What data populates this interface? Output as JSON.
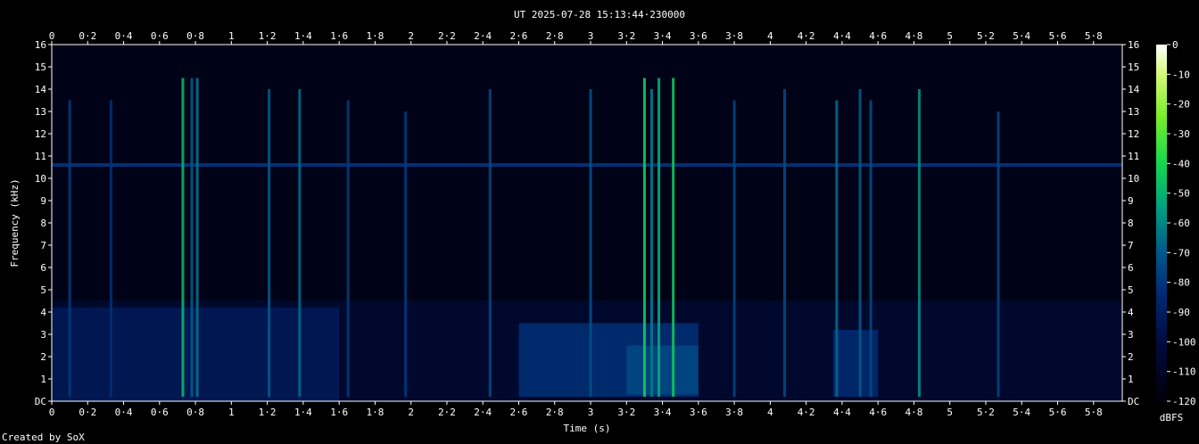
{
  "chart_data": {
    "type": "heatmap",
    "title": "UT 2025-07-28 15:13:44·230000",
    "xlabel": "Time (s)",
    "ylabel": "Frequency (kHz)",
    "xlim": [
      0,
      5.96
    ],
    "ylim": [
      0,
      16
    ],
    "x_ticks": [
      "0",
      "0·2",
      "0·4",
      "0·6",
      "0·8",
      "1",
      "1·2",
      "1·4",
      "1·6",
      "1·8",
      "2",
      "2·2",
      "2·4",
      "2·6",
      "2·8",
      "3",
      "3·2",
      "3·4",
      "3·6",
      "3·8",
      "4",
      "4·2",
      "4·4",
      "4·6",
      "4·8",
      "5",
      "5·2",
      "5·4",
      "5·6",
      "5·8"
    ],
    "y_ticks": [
      "DC",
      "1",
      "2",
      "3",
      "4",
      "5",
      "6",
      "7",
      "8",
      "9",
      "10",
      "11",
      "12",
      "13",
      "14",
      "15",
      "16"
    ],
    "colorbar": {
      "label": "dBFS",
      "ticks": [
        "0",
        "-10",
        "-20",
        "-30",
        "-40",
        "-50",
        "-60",
        "-70",
        "-80",
        "-90",
        "-100",
        "-110",
        "-120"
      ],
      "range": [
        -120,
        0
      ]
    },
    "grid": false,
    "horizontal_lines": [
      {
        "freq_khz": 10.6,
        "level_dbfs": -88
      }
    ],
    "vertical_events": [
      {
        "t": 0.1,
        "top_khz": 13.5,
        "level_dbfs": -85
      },
      {
        "t": 0.33,
        "top_khz": 13.5,
        "level_dbfs": -88
      },
      {
        "t": 0.73,
        "top_khz": 14.5,
        "level_dbfs": -55
      },
      {
        "t": 0.78,
        "top_khz": 14.5,
        "level_dbfs": -75
      },
      {
        "t": 0.81,
        "top_khz": 14.5,
        "level_dbfs": -70
      },
      {
        "t": 1.21,
        "top_khz": 14.0,
        "level_dbfs": -75
      },
      {
        "t": 1.38,
        "top_khz": 14.0,
        "level_dbfs": -72
      },
      {
        "t": 1.65,
        "top_khz": 13.5,
        "level_dbfs": -85
      },
      {
        "t": 1.97,
        "top_khz": 13.0,
        "level_dbfs": -85
      },
      {
        "t": 2.44,
        "top_khz": 14.0,
        "level_dbfs": -80
      },
      {
        "t": 3.0,
        "top_khz": 14.0,
        "level_dbfs": -78
      },
      {
        "t": 3.3,
        "top_khz": 14.5,
        "level_dbfs": -48
      },
      {
        "t": 3.34,
        "top_khz": 14.0,
        "level_dbfs": -68
      },
      {
        "t": 3.38,
        "top_khz": 14.5,
        "level_dbfs": -58
      },
      {
        "t": 3.46,
        "top_khz": 14.5,
        "level_dbfs": -50
      },
      {
        "t": 3.8,
        "top_khz": 13.5,
        "level_dbfs": -82
      },
      {
        "t": 4.08,
        "top_khz": 14.0,
        "level_dbfs": -80
      },
      {
        "t": 4.37,
        "top_khz": 13.5,
        "level_dbfs": -72
      },
      {
        "t": 4.5,
        "top_khz": 14.0,
        "level_dbfs": -75
      },
      {
        "t": 4.56,
        "top_khz": 13.5,
        "level_dbfs": -80
      },
      {
        "t": 4.83,
        "top_khz": 14.0,
        "level_dbfs": -65
      },
      {
        "t": 5.27,
        "top_khz": 13.0,
        "level_dbfs": -82
      }
    ],
    "regions": [
      {
        "t0": 0.0,
        "t1": 1.6,
        "f0_khz": 0,
        "f1_khz": 4.2,
        "level_dbfs": -98
      },
      {
        "t0": 2.6,
        "t1": 3.6,
        "f0_khz": 0.2,
        "f1_khz": 3.5,
        "level_dbfs": -88
      },
      {
        "t0": 3.2,
        "t1": 3.6,
        "f0_khz": 0.3,
        "f1_khz": 2.5,
        "level_dbfs": -80
      },
      {
        "t0": 4.35,
        "t1": 4.6,
        "f0_khz": 0.2,
        "f1_khz": 3.2,
        "level_dbfs": -90
      }
    ]
  },
  "credit": "Created by SoX",
  "colors": {
    "background": "#000000",
    "text": "#ffffff",
    "colormap": [
      "#000008",
      "#000c40",
      "#002a73",
      "#005a8a",
      "#00a37f",
      "#16d84c",
      "#7aee2a",
      "#d8f97a",
      "#ffffff"
    ]
  }
}
